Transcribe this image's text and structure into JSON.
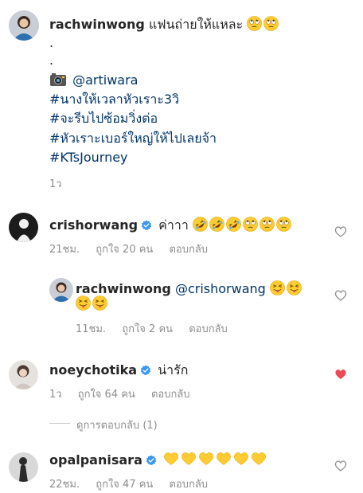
{
  "caption": {
    "username": "rachwinwong",
    "text": "แฟนถ่ายให้แหละ",
    "text_emojis": [
      "rolling-eyes",
      "rolling-eyes"
    ],
    "dot1": ".",
    "dot2": ".",
    "camera_icon": "camera-icon",
    "credit": "@artiwara",
    "hashtags": [
      "#นางให้เวลาหัวเราะ3วิ",
      "#จะรีบไปซ้อมวิ่งต่อ",
      "#หัวเราะเบอร์ใหญ่ให้ไปเลยจ้า",
      "#KTsJourney"
    ],
    "time": "1ว"
  },
  "comments": [
    {
      "username": "crishorwang",
      "verified": true,
      "text": "ค่าาา",
      "emojis": [
        "rofl",
        "rofl",
        "rofl",
        "rolling-eyes",
        "rolling-eyes",
        "rolling-eyes"
      ],
      "time": "21ชม.",
      "likes": "ถูกใจ 20 คน",
      "reply_label": "ตอบกลับ",
      "liked": false
    },
    {
      "username": "rachwinwong",
      "mention": "@crishorwang",
      "emojis": [
        "tongue-squint",
        "tongue-squint",
        "tongue-squint",
        "tongue-squint"
      ],
      "time": "11ชม.",
      "likes": "ถูกใจ 2 คน",
      "reply_label": "ตอบกลับ",
      "liked": false
    },
    {
      "username": "noeychotika",
      "verified": true,
      "text": "น่ารัก",
      "time": "1ว",
      "likes": "ถูกใจ 64 คน",
      "reply_label": "ตอบกลับ",
      "liked": true,
      "view_replies": "ดูการตอบกลับ (1)"
    },
    {
      "username": "opalpanisara",
      "verified": true,
      "emojis": [
        "yellow-heart",
        "yellow-heart",
        "yellow-heart",
        "yellow-heart",
        "yellow-heart",
        "yellow-heart"
      ],
      "time": "22ชม.",
      "likes": "ถูกใจ 47 คน",
      "reply_label": "ตอบกลับ",
      "liked": false
    }
  ],
  "colors": {
    "text": "#262626",
    "meta": "#8e8e8e",
    "hashtag": "#003569",
    "verified": "#3897f0",
    "like_red": "#ed4956",
    "emoji_yellow": "#ffcc33"
  }
}
